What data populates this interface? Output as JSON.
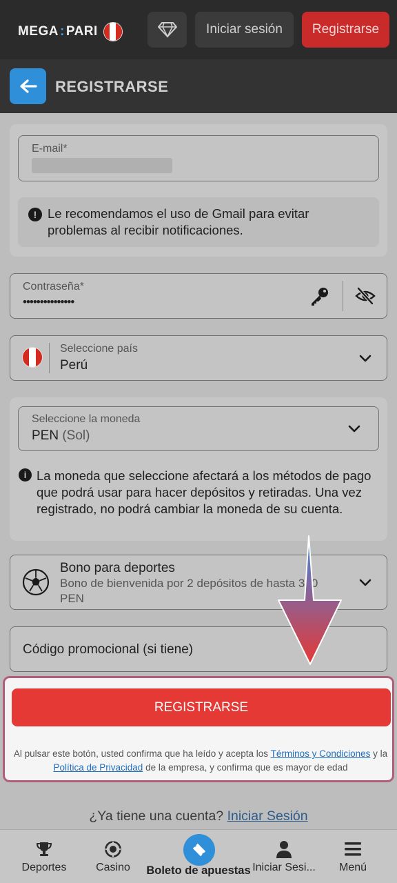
{
  "header": {
    "logo_left": "MEGA",
    "logo_sep": ":",
    "logo_right": "PARI",
    "login_label": "Iniciar sesión",
    "register_label": "Registrarse"
  },
  "subheader": {
    "title": "REGISTRARSE"
  },
  "form": {
    "email": {
      "label": "E-mail*"
    },
    "gmail_note": "Le recomendamos el uso de Gmail para evitar problemas al recibir notificaciones.",
    "password": {
      "label": "Contraseña*",
      "value": "•••••••••••••••"
    },
    "country": {
      "label": "Seleccione país",
      "value": "Perú"
    },
    "currency": {
      "label": "Seleccione la moneda",
      "value": "PEN",
      "value_suffix": "(Sol)"
    },
    "currency_note": "La moneda que seleccione afectará a los métodos de pago que podrá usar para hacer depósitos y retiradas. Una vez registrado, no podrá cambiar la moneda de su cuenta.",
    "bonus": {
      "title": "Bono para deportes",
      "subtitle": "Bono de bienvenida por 2 depósitos de hasta 350 PEN"
    },
    "promo": {
      "placeholder": "Código promocional (si tiene)"
    }
  },
  "register": {
    "button_label": "REGISTRARSE",
    "legal_part1": "Al pulsar este botón, usted confirma que ha leído y acepta los",
    "terms_link": "Términos y Condiciones",
    "legal_part2": "y la",
    "privacy_link": "Política de Privacidad",
    "legal_part3": "de la empresa, y confirma que es mayor de edad"
  },
  "login_prompt": {
    "text": "¿Ya tiene una cuenta?",
    "link": "Iniciar Sesión"
  },
  "bottom_nav": {
    "sports": "Deportes",
    "casino": "Casino",
    "betslip": "Boleto de apuestas",
    "login": "Iniciar Sesi...",
    "menu": "Menú"
  },
  "colors": {
    "accent_red": "#e53935",
    "accent_blue": "#2f8fd8",
    "header_bg": "#2b2b2b"
  },
  "icons": [
    "diamond-icon",
    "back-arrow-icon",
    "key-icon",
    "eye-slash-icon",
    "peru-flag-icon",
    "chevron-down-icon",
    "info-icon",
    "soccer-ball-icon",
    "trophy-icon",
    "casino-chip-icon",
    "ticket-icon",
    "user-icon",
    "hamburger-icon",
    "down-arrow-overlay-icon"
  ]
}
